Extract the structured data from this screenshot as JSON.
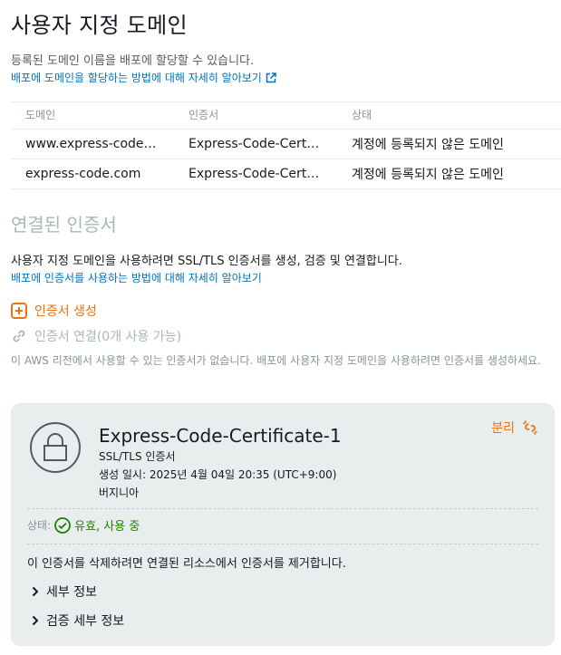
{
  "header": {
    "title": "사용자 지정 도메인",
    "description": "등록된 도메인 이름을 배포에 할당할 수 있습니다.",
    "learn_more": "배포에 도메인을 할당하는 방법에 대해 자세히 알아보기",
    "learn_more_icon": "external-link-icon"
  },
  "domains_table": {
    "columns": [
      "도메인",
      "인증서",
      "상태"
    ],
    "rows": [
      [
        "www.express-code.c…",
        "Express-Code-Certi…",
        "계정에 등록되지 않은 도메인"
      ],
      [
        "express-code.com",
        "Express-Code-Certi…",
        "계정에 등록되지 않은 도메인"
      ]
    ]
  },
  "certificates": {
    "title": "연결된 인증서",
    "description": "사용자 지정 도메인을 사용하려면 SSL/TLS 인증서를 생성, 검증 및 연결합니다.",
    "learn_more": "배포에 인증서를 사용하는 방법에 대해 자세히 알아보기",
    "create_label": "인증서 생성",
    "attach_label": "인증서 연결(0개 사용 가능)",
    "note": "이 AWS 리전에서 사용할 수 있는 인증서가 없습니다. 배포에 사용자 지정 도메인을 사용하려면 인증서를 생성하세요."
  },
  "certificate_card": {
    "name": "Express-Code-Certificate-1",
    "type": "SSL/TLS 인증서",
    "created": "생성 일시: 2025년 4월 04일 20:35 (UTC+9:00)",
    "region": "버지니아",
    "detach_label": "분리",
    "status_label": "상태:",
    "status_value": "유효, 사용 중",
    "delete_note": "이 인증서를 삭제하려면 연결된 리소스에서 인증서를 제거합니다.",
    "details_label": "세부 정보",
    "validation_details_label": "검증 세부 정보"
  },
  "colors": {
    "accent": "#ec7211",
    "link": "#0073bb",
    "success": "#1d8102",
    "muted": "#aab7b8",
    "card_bg": "#eaeded"
  }
}
